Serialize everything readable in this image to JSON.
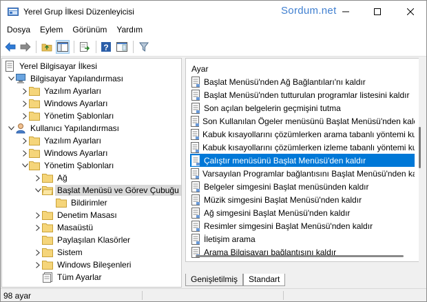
{
  "window": {
    "title": "Yerel Grup İlkesi Düzenleyicisi",
    "watermark": "Sordum.net",
    "accent": "#0078d7"
  },
  "menu": [
    "Dosya",
    "Eylem",
    "Görünüm",
    "Yardım"
  ],
  "toolbar": {
    "buttons": [
      "back-icon",
      "forward-icon",
      "up-folder-icon",
      "show-hide-tree-icon",
      "export-list-icon",
      "help-icon",
      "properties-view-icon",
      "filter-icon"
    ]
  },
  "tree": {
    "root": "Yerel Bilgisayar İlkesi",
    "items": [
      {
        "label": "Bilgisayar Yapılandırması",
        "expanded": true
      },
      {
        "label": "Yazılım Ayarları"
      },
      {
        "label": "Windows Ayarları"
      },
      {
        "label": "Yönetim Şablonları"
      },
      {
        "label": "Kullanıcı Yapılandırması",
        "expanded": true
      },
      {
        "label": "Yazılım Ayarları"
      },
      {
        "label": "Windows Ayarları"
      },
      {
        "label": "Yönetim Şablonları",
        "expanded": true
      },
      {
        "label": "Ağ"
      },
      {
        "label": "Başlat Menüsü ve Görev Çubuğu",
        "selected": true,
        "expanded": true
      },
      {
        "label": "Bildirimler"
      },
      {
        "label": "Denetim Masası"
      },
      {
        "label": "Masaüstü"
      },
      {
        "label": "Paylaşılan Klasörler"
      },
      {
        "label": "Sistem"
      },
      {
        "label": "Windows Bileşenleri"
      },
      {
        "label": "Tüm Ayarlar"
      }
    ]
  },
  "list": {
    "header": "Ayar",
    "selected_index": 6,
    "items": [
      "Başlat Menüsü'nden Ağ Bağlantıları'nı kaldır",
      "Başlat Menüsü'nden tutturulan programlar listesini kaldır",
      "Son açılan belgelerin geçmişini tutma",
      "Son Kullanılan Ögeler menüsünü Başlat Menüsü'nden kaldır",
      "Kabuk kısayollarını çözümlerken arama tabanlı yöntemi kullanma",
      "Kabuk kısayollarını çözümlerken izleme tabanlı yöntemi kullanma",
      "Çalıştır menüsünü Başlat Menüsü'den kaldır",
      "Varsayılan Programlar bağlantısını Başlat Menüsü'nden kaldır",
      "Belgeler simgesini Başlat menüsünden kaldır",
      "Müzik simgesini Başlat Menüsü'nden kaldır",
      "Ağ simgesini Başlat Menüsü'nden kaldır",
      "Resimler simgesini Başlat Menüsü'nden kaldır",
      "İletişim arama",
      "Arama Bilgisayarı bağlantısını kaldır"
    ]
  },
  "tabs": [
    "Genişletilmiş",
    "Standart"
  ],
  "status": {
    "count_text": "98 ayar"
  }
}
